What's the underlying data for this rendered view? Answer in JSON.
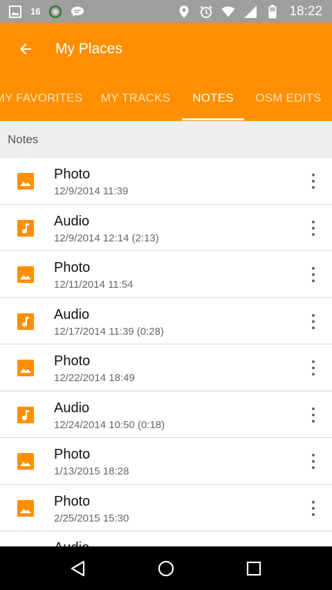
{
  "status_bar": {
    "sim_label": "16",
    "time": "18:22",
    "icons": [
      "image-icon",
      "sim-icon",
      "circle-icon",
      "chat-icon",
      "location-icon",
      "alarm-icon",
      "wifi-icon",
      "signal-icon",
      "battery-icon"
    ]
  },
  "app_bar": {
    "title": "My Places",
    "back_icon": "arrow-back-icon"
  },
  "tabs": [
    {
      "label": "MY FAVORITES",
      "active": false
    },
    {
      "label": "MY TRACKS",
      "active": false
    },
    {
      "label": "NOTES",
      "active": true
    },
    {
      "label": "OSM EDITS",
      "active": false
    }
  ],
  "section": {
    "label": "Notes"
  },
  "notes": [
    {
      "type": "photo",
      "title": "Photo",
      "subtitle": "12/9/2014 11:39"
    },
    {
      "type": "audio",
      "title": "Audio",
      "subtitle": "12/9/2014 12:14 (2:13)"
    },
    {
      "type": "photo",
      "title": "Photo",
      "subtitle": "12/11/2014 11:54"
    },
    {
      "type": "audio",
      "title": "Audio",
      "subtitle": "12/17/2014 11:39 (0:28)"
    },
    {
      "type": "photo",
      "title": "Photo",
      "subtitle": "12/22/2014 18:49"
    },
    {
      "type": "audio",
      "title": "Audio",
      "subtitle": "12/24/2014 10:50 (0:18)"
    },
    {
      "type": "photo",
      "title": "Photo",
      "subtitle": "1/13/2015 18:28"
    },
    {
      "type": "photo",
      "title": "Photo",
      "subtitle": "2/25/2015 15:30"
    },
    {
      "type": "audio",
      "title": "Audio",
      "subtitle": ""
    }
  ],
  "colors": {
    "accent": "#ff8f00",
    "status_bar": "#9e9e9e",
    "section_bg": "#eeeeee",
    "nav_bar": "#000000"
  },
  "nav_bar": {
    "icons": [
      "back-triangle-icon",
      "home-circle-icon",
      "recents-square-icon"
    ]
  }
}
